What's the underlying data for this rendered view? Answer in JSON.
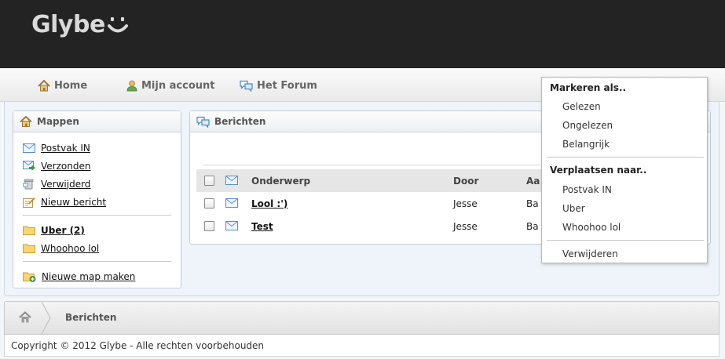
{
  "app": {
    "logo_text": "Glybe"
  },
  "nav": {
    "items": [
      {
        "label": "Home",
        "icon": "home-icon"
      },
      {
        "label": "Mijn account",
        "icon": "user-icon"
      },
      {
        "label": "Het Forum",
        "icon": "forum-icon"
      }
    ]
  },
  "folders": {
    "title": "Mappen",
    "items": [
      {
        "label": "Postvak IN",
        "icon": "inbox-icon"
      },
      {
        "label": "Verzonden",
        "icon": "sent-icon"
      },
      {
        "label": "Verwijderd",
        "icon": "trash-icon"
      },
      {
        "label": "Nieuw bericht",
        "icon": "compose-icon"
      }
    ],
    "custom": [
      {
        "label": "Uber (2)",
        "icon": "folder-icon",
        "bold": true
      },
      {
        "label": "Whoohoo lol",
        "icon": "folder-icon",
        "bold": false
      }
    ],
    "new_folder_label": "Nieuwe map maken"
  },
  "messages": {
    "title": "Berichten",
    "columns": {
      "subject": "Onderwerp",
      "from": "Door",
      "date": "Aa"
    },
    "rows": [
      {
        "subject": "Lool :')",
        "from": "Jesse",
        "date": "Ba"
      },
      {
        "subject": "Test",
        "from": "Jesse",
        "date": "Ba"
      }
    ]
  },
  "dropdown": {
    "mark_heading": "Markeren als..",
    "mark_items": [
      "Gelezen",
      "Ongelezen",
      "Belangrijk"
    ],
    "move_heading": "Verplaatsen naar..",
    "move_items": [
      "Postvak IN",
      "Uber",
      "Whoohoo lol"
    ],
    "delete_label": "Verwijderen"
  },
  "breadcrumb": {
    "current": "Berichten"
  },
  "footer": {
    "text": "Copyright © 2012 Glybe - Alle rechten voorbehouden"
  },
  "colors": {
    "header_bg": "#232323",
    "content_bg": "#eef4fa"
  }
}
